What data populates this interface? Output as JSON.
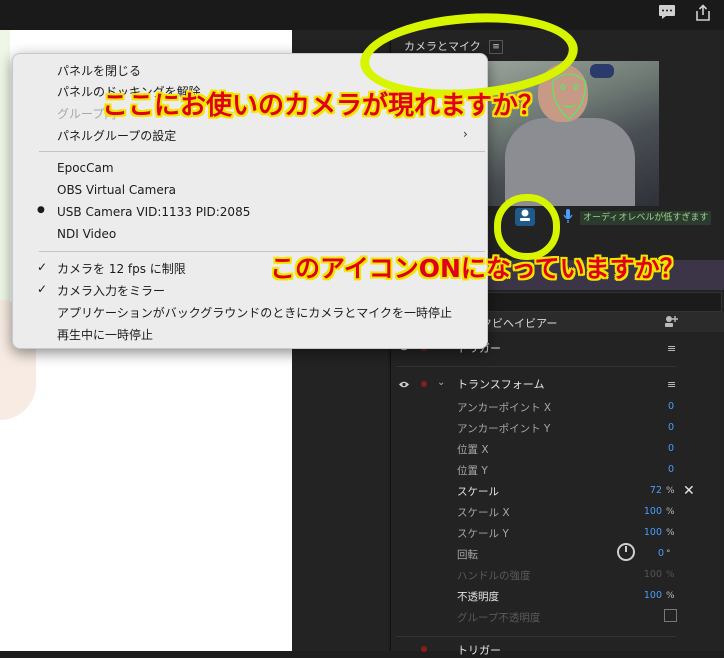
{
  "topbar": {
    "icons": [
      "comment-icon",
      "share-icon"
    ]
  },
  "camera_panel": {
    "title": "カメラとマイク",
    "menu_glyph": "≡",
    "audio_warning": "オーディオレベルが低すぎます"
  },
  "properties_panel": {
    "title": "ックビヘイビアー",
    "triggers_title": "トリガー",
    "transform_title": "トランスフォーム",
    "rows": [
      {
        "label": "アンカーポイント X",
        "value": "0",
        "unit": ""
      },
      {
        "label": "アンカーポイント Y",
        "value": "0",
        "unit": ""
      },
      {
        "label": "位置 X",
        "value": "0",
        "unit": ""
      },
      {
        "label": "位置 Y",
        "value": "0",
        "unit": ""
      },
      {
        "label": "スケール",
        "value": "72",
        "unit": "%"
      },
      {
        "label": "スケール X",
        "value": "100",
        "unit": "%"
      },
      {
        "label": "スケール Y",
        "value": "100",
        "unit": "%"
      },
      {
        "label": "回転",
        "value": "0",
        "unit": "°"
      },
      {
        "label": "ハンドルの強度",
        "value": "100",
        "unit": "%"
      },
      {
        "label": "不透明度",
        "value": "100",
        "unit": "%"
      },
      {
        "label": "グループ不透明度",
        "value": "",
        "unit": ""
      }
    ],
    "bottom_label": "トリガー"
  },
  "context_menu": {
    "items": {
      "close_panel": "パネルを閉じる",
      "undock_panel": "パネルのドッキングを解除",
      "group_partial": "グループ内",
      "panel_group_settings": "パネルグループの設定",
      "epoccam": "EpocCam",
      "obs_virtual_camera": "OBS Virtual Camera",
      "usb_camera": "USB Camera VID:1133 PID:2085",
      "ndi_video": "NDI Video",
      "limit_fps": "カメラを 12 fps に制限",
      "mirror_camera": "カメラ入力をミラー",
      "pause_background": "アプリケーションがバックグラウンドのときにカメラとマイクを一時停止",
      "pause_playback": "再生中に一時停止"
    },
    "selected_bullet": "●",
    "check_glyph": "✓",
    "submenu_glyph": "›"
  },
  "annotations": {
    "camera_question": "ここにお使いのカメラが現れますか？",
    "icon_question": "このアイコンONになっていますか？"
  },
  "colors": {
    "annotation_text": "#e0001a",
    "annotation_outline": "#f2e600",
    "highlight": "#d8f500",
    "accent": "#4a9eff"
  }
}
